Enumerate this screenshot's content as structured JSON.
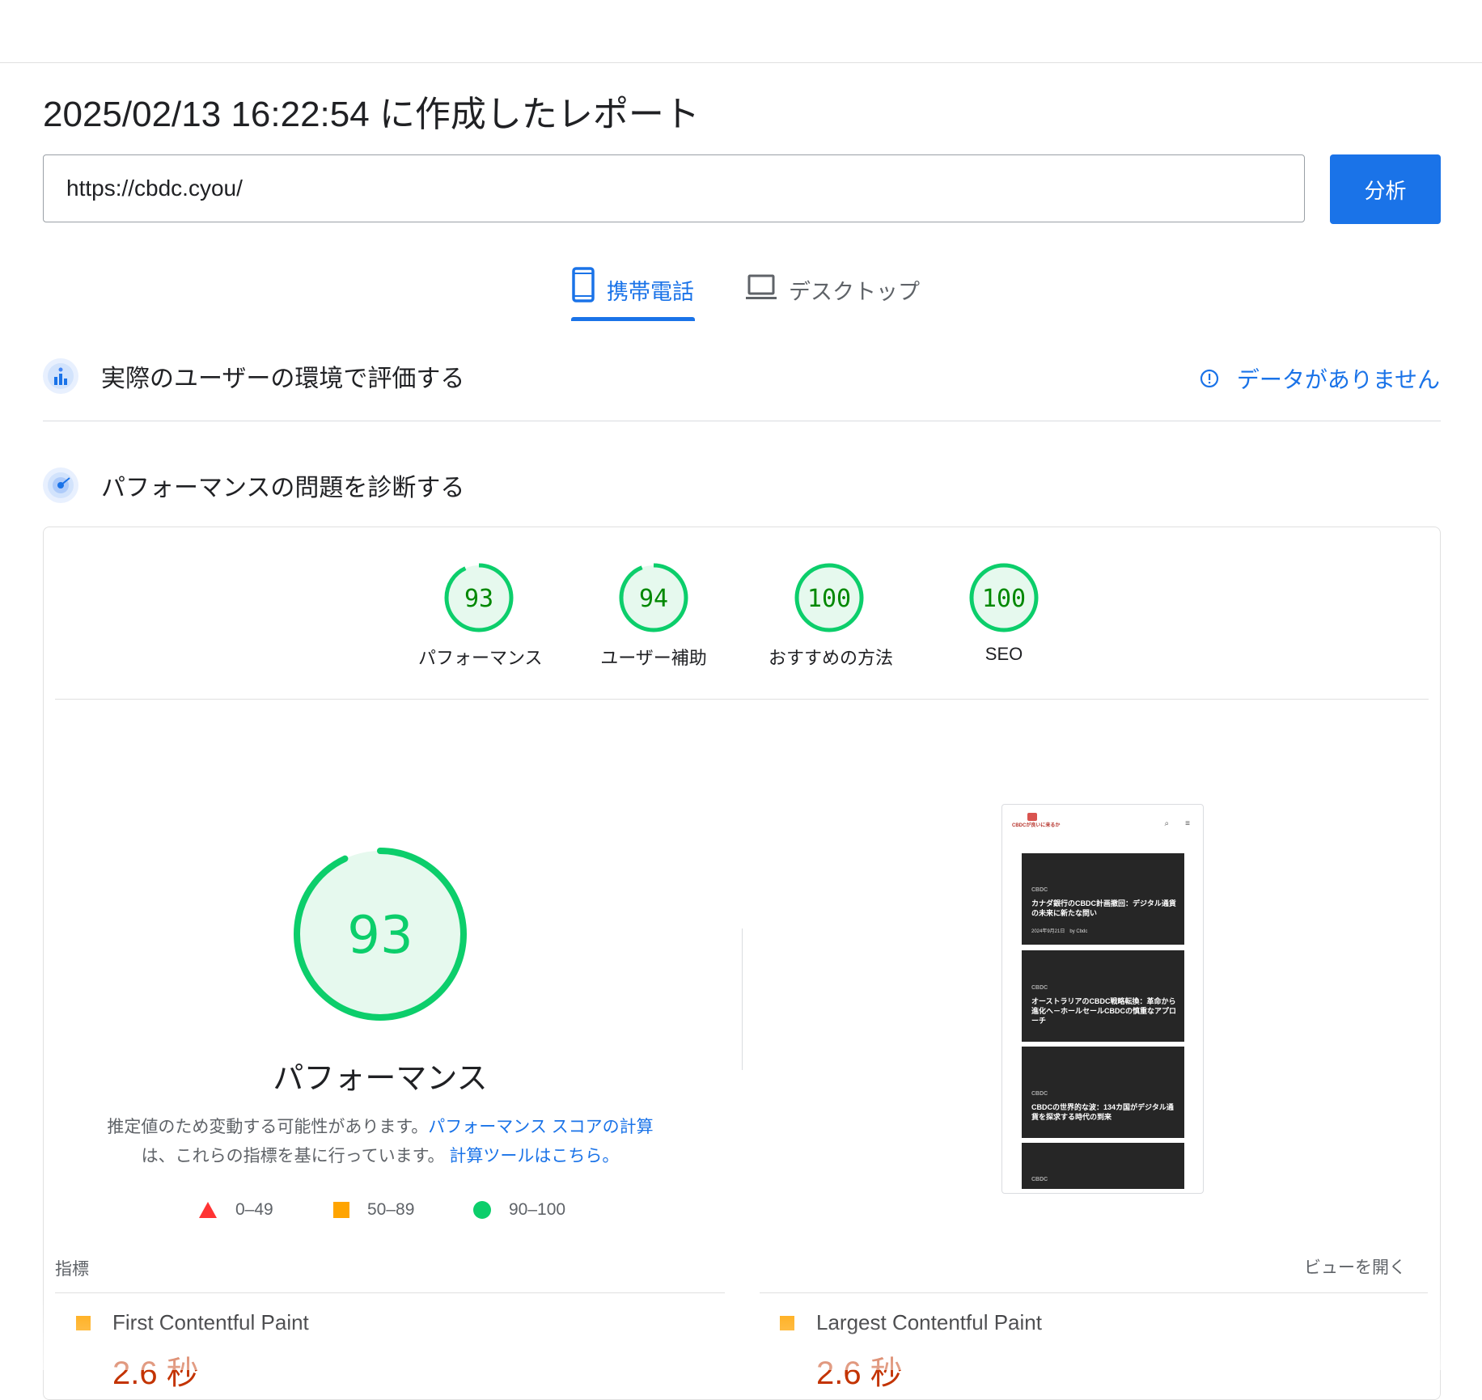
{
  "report": {
    "title": "2025/02/13 16:22:54 に作成したレポート"
  },
  "search": {
    "url": "https://cbdc.cyou/",
    "analyze_label": "分析"
  },
  "tabs": [
    {
      "label": "携帯電話",
      "icon": "phone-icon",
      "active": true
    },
    {
      "label": "デスクトップ",
      "icon": "laptop-icon",
      "active": false
    }
  ],
  "field_data": {
    "title": "実際のユーザーの環境で評価する",
    "no_data_label": "データがありません",
    "icon": "users-chart-icon"
  },
  "diagnose": {
    "title": "パフォーマンスの問題を診断する",
    "icon": "lighthouse-icon"
  },
  "scores": [
    {
      "label": "パフォーマンス",
      "value": "93",
      "score": 93
    },
    {
      "label": "ユーザー補助",
      "value": "94",
      "score": 94
    },
    {
      "label": "おすすめの方法",
      "value": "100",
      "score": 100
    },
    {
      "label": "SEO",
      "value": "100",
      "score": 100
    }
  ],
  "performance": {
    "score": "93",
    "score_value": 93,
    "title": "パフォーマンス",
    "desc_prefix": "推定値のため変動する可能性があります。",
    "desc_link1": "パフォーマンス スコアの計算",
    "desc_middle": "は、これらの指標を基に行っています。",
    "desc_link2": "計算ツールはこちら。"
  },
  "legend": [
    {
      "range": "0–49",
      "shape": "triangle",
      "color": "#ff3333"
    },
    {
      "range": "50–89",
      "shape": "square",
      "color": "#ffa400"
    },
    {
      "range": "90–100",
      "shape": "circle",
      "color": "#0cce6b"
    }
  ],
  "metrics": {
    "label": "指標",
    "expand_label": "ビューを開く",
    "items": [
      {
        "name": "First Contentful Paint",
        "value": "2.6 秒"
      },
      {
        "name": "Largest Contentful Paint",
        "value": "2.6 秒"
      }
    ]
  },
  "screenshot": {
    "logo_text": "CBDCが良いに来るか",
    "posts": [
      {
        "tag": "CBDC",
        "title": "カナダ銀行のCBDC計画撤回：デジタル通貨の未来に新たな問い",
        "meta": "2024年9月21日　by Cbdc"
      },
      {
        "tag": "CBDC",
        "title": "オーストラリアのCBDC戦略転換：革命から進化へ－ホールセールCBDCの慎重なアプローチ",
        "meta": ""
      },
      {
        "tag": "CBDC",
        "title": "CBDCの世界的な波：134カ国がデジタル通貨を探求する時代の到来",
        "meta": ""
      },
      {
        "tag": "CBDC",
        "title": "",
        "meta": ""
      }
    ]
  },
  "colors": {
    "accent": "#1a73e8",
    "pass": "#0cce6b",
    "average": "#ffa400",
    "fail": "#c33300"
  }
}
